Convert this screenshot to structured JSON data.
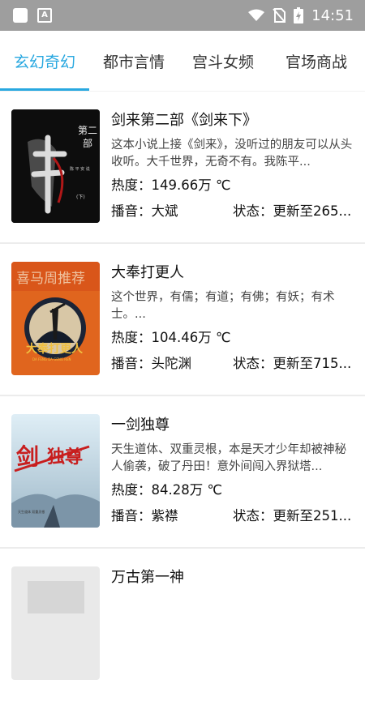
{
  "status_bar": {
    "time": "14:51"
  },
  "tabs": [
    {
      "label": "玄幻奇幻",
      "active": true
    },
    {
      "label": "都市言情",
      "active": false
    },
    {
      "label": "宫斗女频",
      "active": false
    },
    {
      "label": "官场商战",
      "active": false
    }
  ],
  "books": [
    {
      "title": "剑来第二部《剑来下》",
      "description": "这本小说上接《剑来》，没听过的朋友可以从头收听。大千世界，无奇不有。我陈平...",
      "heat_label": "热度：",
      "heat_value": "149.66万 ℃",
      "narrator_label": "播音：",
      "narrator": "大斌",
      "status_label": "状态：",
      "status": "更新至265...",
      "cover_text": "剑 第二部"
    },
    {
      "title": "大奉打更人",
      "description": "这个世界，有儒；有道；有佛；有妖；有术士。...",
      "heat_label": "热度：",
      "heat_value": "104.46万 ℃",
      "narrator_label": "播音：",
      "narrator": "头陀渊",
      "status_label": "状态：",
      "status": "更新至715...",
      "cover_text": "大奉打更人"
    },
    {
      "title": "一剑独尊",
      "description": "天生道体、双重灵根，本是天才少年却被神秘人偷袭，破了丹田！意外间闯入界狱塔...",
      "heat_label": "热度：",
      "heat_value": "84.28万 ℃",
      "narrator_label": "播音：",
      "narrator": "紫襟",
      "status_label": "状态：",
      "status": "更新至251...",
      "cover_text": "一剑独尊"
    },
    {
      "title": "万古第一神",
      "description": "",
      "heat_label": "",
      "heat_value": "",
      "narrator_label": "",
      "narrator": "",
      "status_label": "",
      "status": "",
      "cover_text": ""
    }
  ]
}
